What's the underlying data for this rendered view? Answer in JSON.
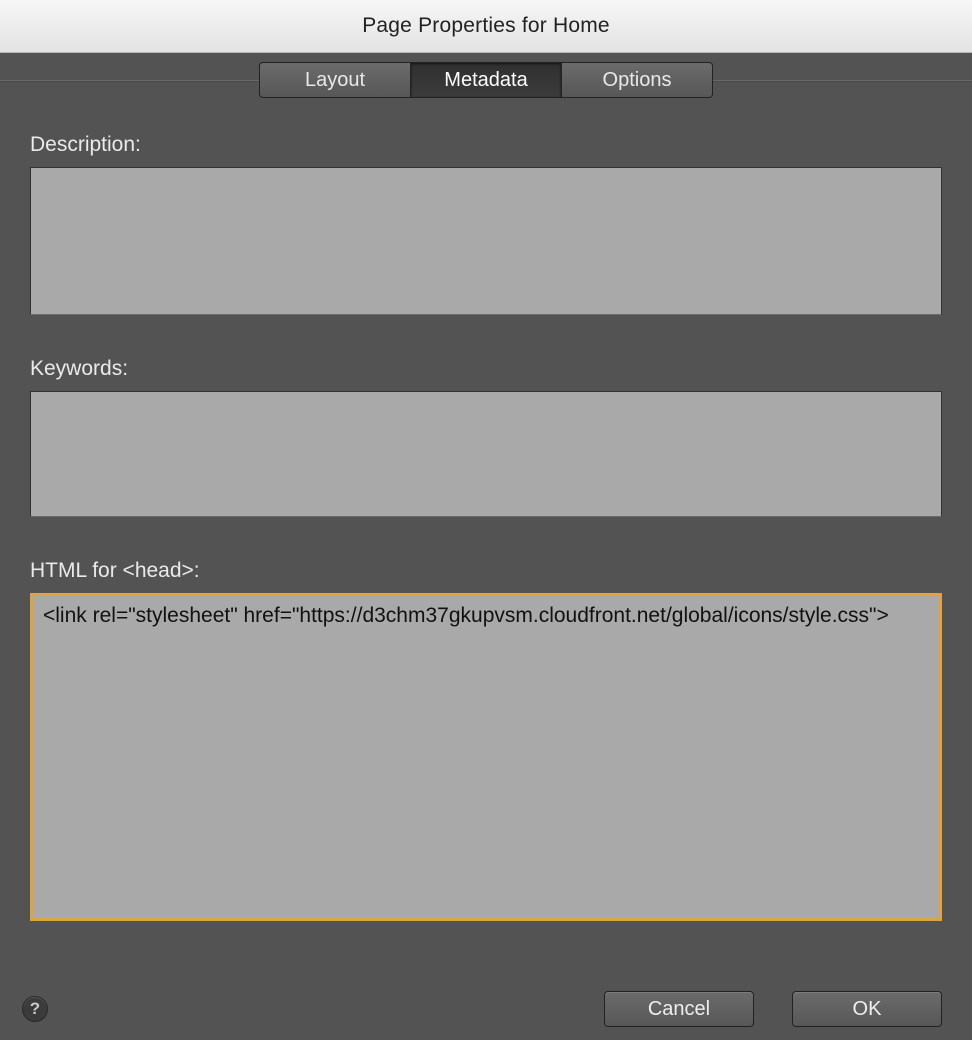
{
  "dialog": {
    "title": "Page Properties for Home"
  },
  "tabs": [
    {
      "label": "Layout",
      "selected": false
    },
    {
      "label": "Metadata",
      "selected": true
    },
    {
      "label": "Options",
      "selected": false
    }
  ],
  "fields": {
    "description": {
      "label": "Description:",
      "value": ""
    },
    "keywords": {
      "label": "Keywords:",
      "value": ""
    },
    "html_head": {
      "label": "HTML for <head>:",
      "value": "<link rel=\"stylesheet\" href=\"https://d3chm37gkupvsm.cloudfront.net/global/icons/style.css\">"
    }
  },
  "footer": {
    "help_title": "?",
    "cancel": "Cancel",
    "ok": "OK"
  }
}
